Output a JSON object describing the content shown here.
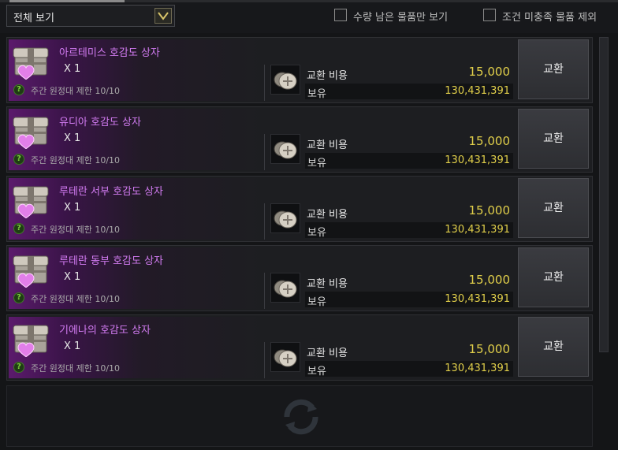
{
  "filter": {
    "selected": "전체 보기"
  },
  "checkboxes": [
    {
      "label": "수량 남은 물품만 보기",
      "checked": false
    },
    {
      "label": "조건 미충족 물품 제외",
      "checked": false
    }
  ],
  "items": [
    {
      "name": "아르테미스 호감도 상자",
      "qty": "X 1",
      "limit": "주간 원정대 제한 10/10",
      "cost_label": "교환 비용",
      "cost": "15,000",
      "own_label": "보유",
      "own": "130,431,391",
      "button": "교환"
    },
    {
      "name": "유디아 호감도 상자",
      "qty": "X 1",
      "limit": "주간 원정대 제한 10/10",
      "cost_label": "교환 비용",
      "cost": "15,000",
      "own_label": "보유",
      "own": "130,431,391",
      "button": "교환"
    },
    {
      "name": "루테란 서부 호감도 상자",
      "qty": "X 1",
      "limit": "주간 원정대 제한 10/10",
      "cost_label": "교환 비용",
      "cost": "15,000",
      "own_label": "보유",
      "own": "130,431,391",
      "button": "교환"
    },
    {
      "name": "루테란 동부 호감도 상자",
      "qty": "X 1",
      "limit": "주간 원정대 제한 10/10",
      "cost_label": "교환 비용",
      "cost": "15,000",
      "own_label": "보유",
      "own": "130,431,391",
      "button": "교환"
    },
    {
      "name": "기에나의 호감도 상자",
      "qty": "X 1",
      "limit": "주간 원정대 제한 10/10",
      "cost_label": "교환 비용",
      "cost": "15,000",
      "own_label": "보유",
      "own": "130,431,391",
      "button": "교환"
    }
  ],
  "icons": {
    "item": "gift-chest-icon",
    "currency": "silver-coin-icon",
    "help": "help-icon",
    "refresh": "refresh-icon"
  },
  "colors": {
    "item_name": "#d37cf3",
    "value": "#e1cf4a",
    "help": "#7fd43a"
  }
}
